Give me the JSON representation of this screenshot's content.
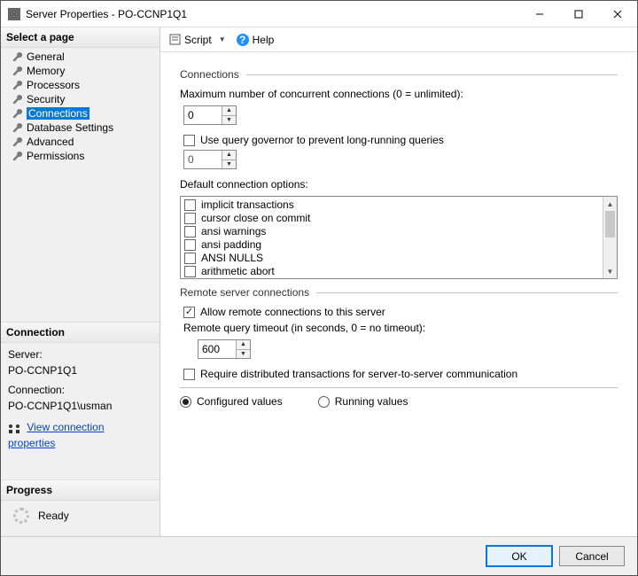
{
  "window": {
    "title": "Server Properties - PO-CCNP1Q1"
  },
  "sidebar": {
    "select_page_header": "Select a page",
    "pages": [
      {
        "label": "General"
      },
      {
        "label": "Memory"
      },
      {
        "label": "Processors"
      },
      {
        "label": "Security"
      },
      {
        "label": "Connections",
        "selected": true
      },
      {
        "label": "Database Settings"
      },
      {
        "label": "Advanced"
      },
      {
        "label": "Permissions"
      }
    ],
    "connection_header": "Connection",
    "server_label": "Server:",
    "server_value": "PO-CCNP1Q1",
    "connection_label": "Connection:",
    "connection_value": "PO-CCNP1Q1\\usman",
    "view_props_link": "View connection properties",
    "progress_header": "Progress",
    "progress_value": "Ready"
  },
  "toolbar": {
    "script_label": "Script",
    "help_label": "Help"
  },
  "content": {
    "connections_group": "Connections",
    "max_conn_label": "Maximum number of concurrent connections (0 = unlimited):",
    "max_conn_value": "0",
    "query_governor_label": "Use query governor to prevent long-running queries",
    "query_governor_checked": false,
    "query_governor_value": "0",
    "default_opts_label": "Default connection options:",
    "default_opts": [
      {
        "label": "implicit transactions",
        "checked": false
      },
      {
        "label": "cursor close on commit",
        "checked": false
      },
      {
        "label": "ansi warnings",
        "checked": false
      },
      {
        "label": "ansi padding",
        "checked": false
      },
      {
        "label": "ANSI NULLS",
        "checked": false
      },
      {
        "label": "arithmetic abort",
        "checked": false
      }
    ],
    "remote_group": "Remote server connections",
    "allow_remote_label": "Allow remote connections to this server",
    "allow_remote_checked": true,
    "remote_timeout_label": "Remote query timeout (in seconds, 0 = no timeout):",
    "remote_timeout_value": "600",
    "require_dtc_label": "Require distributed transactions for server-to-server communication",
    "require_dtc_checked": false,
    "configured_values_label": "Configured values",
    "running_values_label": "Running values",
    "values_mode": "configured"
  },
  "footer": {
    "ok_label": "OK",
    "cancel_label": "Cancel"
  }
}
